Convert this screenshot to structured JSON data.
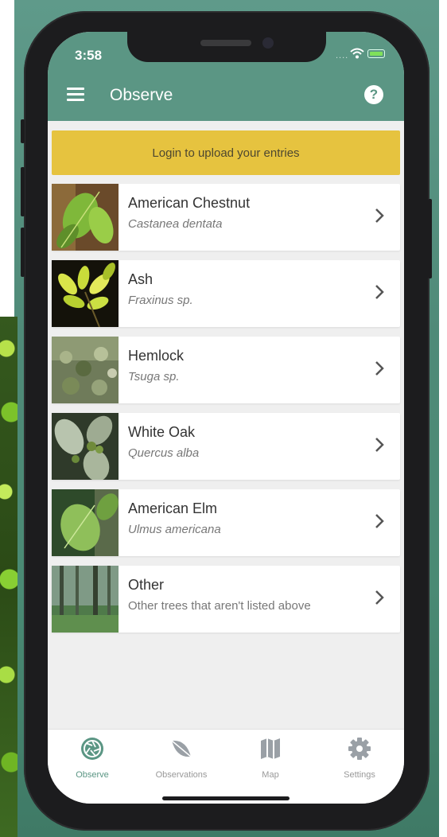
{
  "status": {
    "time": "3:58"
  },
  "appbar": {
    "title": "Observe"
  },
  "banner": {
    "text": "Login to upload your entries"
  },
  "trees": [
    {
      "name": "American Chestnut",
      "subtitle": "Castanea dentata"
    },
    {
      "name": "Ash",
      "subtitle": "Fraxinus sp."
    },
    {
      "name": "Hemlock",
      "subtitle": "Tsuga sp."
    },
    {
      "name": "White Oak",
      "subtitle": "Quercus alba"
    },
    {
      "name": "American Elm",
      "subtitle": "Ulmus americana"
    },
    {
      "name": "Other",
      "subtitle": "Other trees that aren't listed above"
    }
  ],
  "tabs": [
    {
      "label": "Observe",
      "icon": "camera-aperture-icon",
      "active": true
    },
    {
      "label": "Observations",
      "icon": "leaf-icon",
      "active": false
    },
    {
      "label": "Map",
      "icon": "map-icon",
      "active": false
    },
    {
      "label": "Settings",
      "icon": "gear-icon",
      "active": false
    }
  ],
  "colors": {
    "primary": "#5b9684",
    "banner": "#e6c33f",
    "background": "#efefef"
  }
}
